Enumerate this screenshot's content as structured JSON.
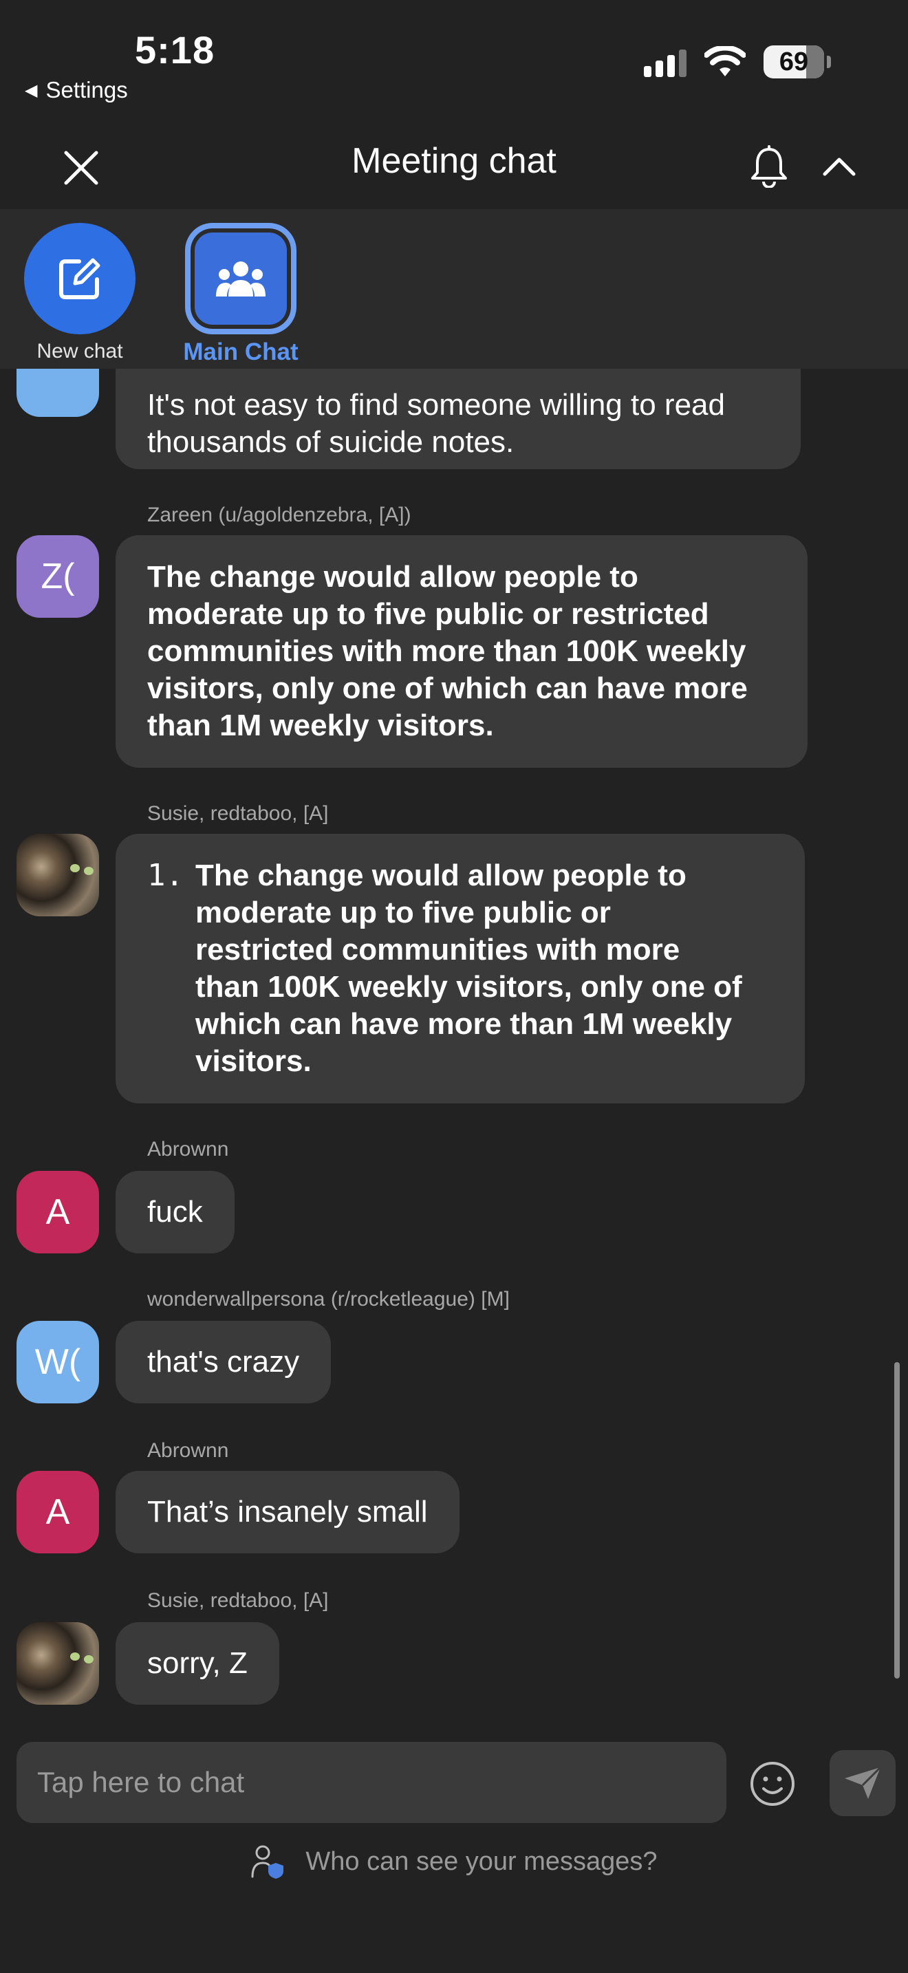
{
  "status_bar": {
    "time": "5:18",
    "back_label": "Settings",
    "battery": "69"
  },
  "header": {
    "title": "Meeting chat",
    "close_icon": "close-icon",
    "bell_icon": "bell-icon",
    "collapse_icon": "chevron-up-icon"
  },
  "tabs": [
    {
      "label": "New chat",
      "icon": "compose-icon"
    },
    {
      "label": "Main Chat",
      "icon": "group-icon",
      "selected": true
    }
  ],
  "messages": [
    {
      "sender": "",
      "avatar": "",
      "lines": [
        "It's not easy to find someone willing to read",
        "thousands of suicide notes."
      ]
    },
    {
      "sender": "Zareen (u/agoldenzebra, [A])",
      "avatar": "Z(",
      "avatar_color": "#8e75c9",
      "lines": [
        "The change would allow people to",
        "moderate up to five public or restricted",
        "communities with more than 100K weekly",
        "visitors, only one of which can have more",
        "than 1M weekly visitors."
      ]
    },
    {
      "sender": "Susie, redtaboo, [A]",
      "avatar": "cat-photo",
      "list_number": "1.",
      "lines": [
        "The change would allow people to",
        "moderate up to five public or",
        "restricted communities with more",
        "than 100K weekly visitors, only one of",
        "which can have more than 1M weekly",
        "visitors."
      ]
    },
    {
      "sender": "Abrownn",
      "avatar": "A",
      "avatar_color": "#c2285a",
      "text": "fuck"
    },
    {
      "sender": "wonderwallpersona (r/rocketleague) [M]",
      "avatar": "W(",
      "avatar_color": "#76b1ee",
      "text": "that's crazy"
    },
    {
      "sender": "Abrownn",
      "avatar": "A",
      "avatar_color": "#c2285a",
      "text": "That’s insanely small"
    },
    {
      "sender": "Susie, redtaboo, [A]",
      "avatar": "cat-photo",
      "text": "sorry, Z"
    }
  ],
  "composer": {
    "placeholder": "Tap here to chat",
    "emoji_icon": "smiley-icon",
    "send_icon": "send-icon"
  },
  "privacy": {
    "label": "Who can see your messages?",
    "icon": "user-shield-icon"
  },
  "colors": {
    "background": "#222222",
    "bubble": "#3a3a3a",
    "accent": "#2f6fe4",
    "selected_tab_text": "#5b95f5"
  }
}
